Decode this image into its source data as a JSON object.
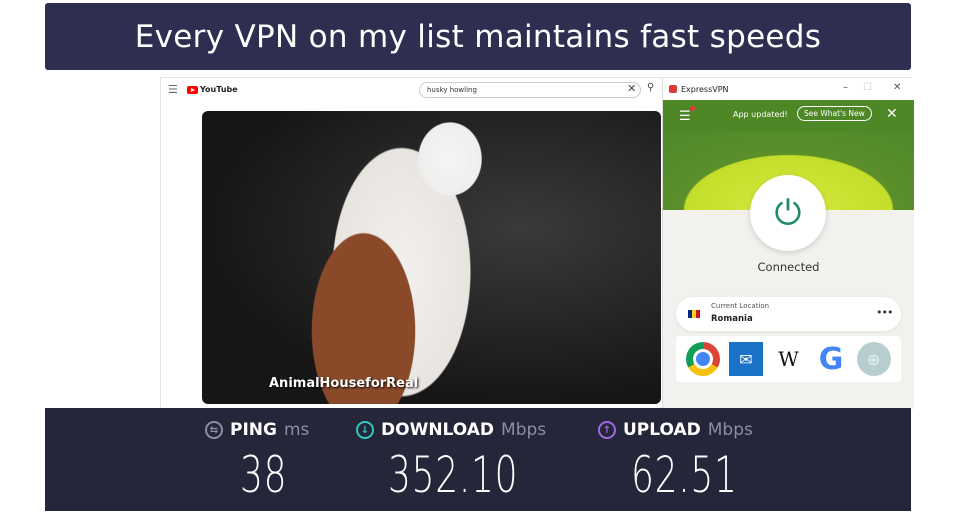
{
  "banner": {
    "title": "Every VPN on my list maintains fast speeds"
  },
  "youtube": {
    "logo": "YouTube",
    "search_value": "husky howling",
    "video_caption": "AnimalHouseforReal"
  },
  "expressvpn": {
    "title": "ExpressVPN",
    "notice": "App updated!",
    "whats_new": "See What's New",
    "status": "Connected",
    "location_label": "Current Location",
    "location_value": "Romania",
    "shortcuts": [
      "chrome-icon",
      "mail-icon",
      "wikipedia-icon",
      "google-icon",
      "add-icon"
    ],
    "accent": "#1f8a6a"
  },
  "speed": {
    "ping": {
      "label": "PING",
      "unit": "ms",
      "value": "38",
      "color": "#8b8da2"
    },
    "download": {
      "label": "DOWNLOAD",
      "unit": "Mbps",
      "value": "352.10",
      "color": "#2fc9c0"
    },
    "upload": {
      "label": "UPLOAD",
      "unit": "Mbps",
      "value": "62.51",
      "color": "#a06ae0"
    }
  }
}
